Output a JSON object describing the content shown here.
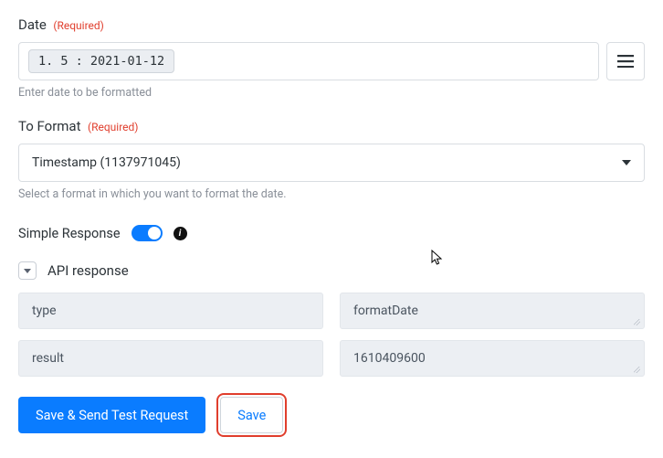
{
  "dateField": {
    "label": "Date",
    "required": "(Required)",
    "pillValue": "1. 5 : 2021-01-12",
    "helper": "Enter date to be formatted"
  },
  "toFormatField": {
    "label": "To Format",
    "required": "(Required)",
    "selected": "Timestamp (1137971045)",
    "helper": "Select a format in which you want to format the date."
  },
  "simpleResponse": {
    "label": "Simple Response",
    "enabled": true
  },
  "apiResponse": {
    "title": "API response",
    "rows": [
      {
        "key": "type",
        "value": "formatDate"
      },
      {
        "key": "result",
        "value": "1610409600"
      }
    ]
  },
  "buttons": {
    "primary": "Save & Send Test Request",
    "secondary": "Save"
  }
}
